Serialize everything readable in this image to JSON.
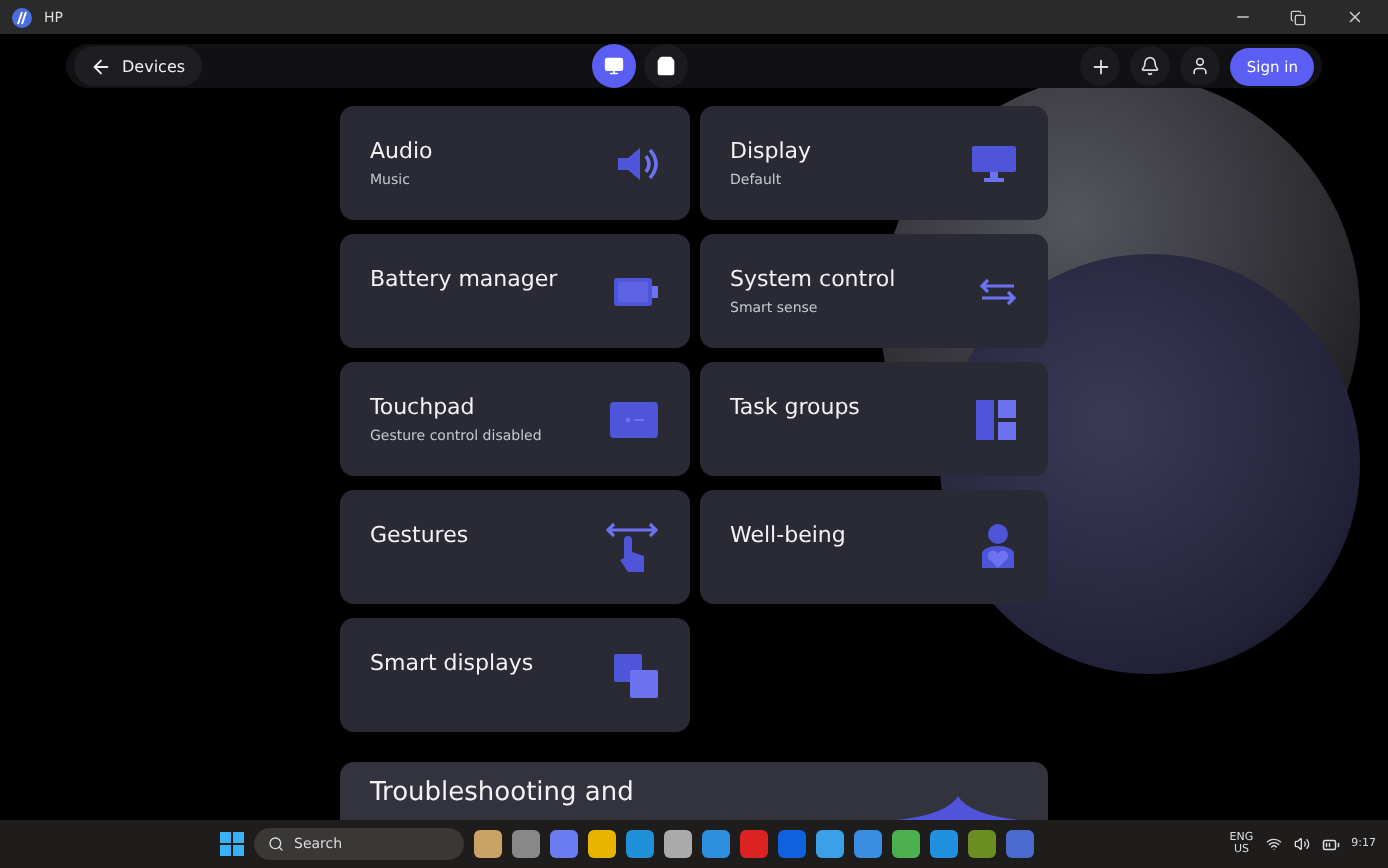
{
  "window": {
    "title": "HP"
  },
  "nav": {
    "back_label": "Devices",
    "views": [
      {
        "selected": true
      },
      {
        "selected": false
      }
    ],
    "sign_in": "Sign in"
  },
  "cards": [
    {
      "title": "Audio",
      "subtitle": "Music"
    },
    {
      "title": "Display",
      "subtitle": "Default"
    },
    {
      "title": "Battery manager"
    },
    {
      "title": "System control",
      "subtitle": "Smart sense"
    },
    {
      "title": "Touchpad",
      "subtitle": "Gesture control disabled"
    },
    {
      "title": "Task groups"
    },
    {
      "title": "Gestures"
    },
    {
      "title": "Well-being"
    },
    {
      "title": "Smart displays"
    }
  ],
  "banner": {
    "title": "Troubleshooting and"
  },
  "taskbar": {
    "search_placeholder": "Search",
    "language": "ENG",
    "region": "US",
    "time": "9:17"
  }
}
